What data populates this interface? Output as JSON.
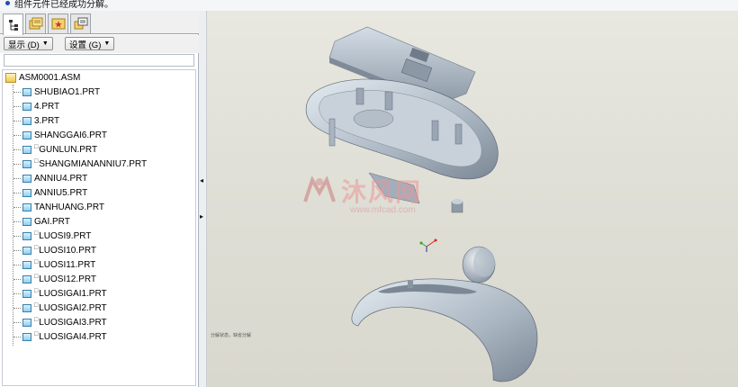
{
  "message_bar": {
    "text": "组件元件已经成功分解。"
  },
  "left_panel": {
    "tabs": [
      {
        "name": "model-tree-tab",
        "icon": "model-tree-icon"
      },
      {
        "name": "folder-browser-tab",
        "icon": "folder-browser-icon"
      },
      {
        "name": "favorites-tab",
        "icon": "favorites-icon"
      },
      {
        "name": "layers-tab",
        "icon": "layers-icon"
      }
    ],
    "show_button": "显示 (D)",
    "settings_button": "设置 (G)",
    "tree": {
      "root": "ASM0001.ASM",
      "items": [
        {
          "label": "SHUBIAO1.PRT",
          "marked": false
        },
        {
          "label": "4.PRT",
          "marked": false
        },
        {
          "label": "3.PRT",
          "marked": false
        },
        {
          "label": "SHANGGAI6.PRT",
          "marked": false
        },
        {
          "label": "GUNLUN.PRT",
          "marked": true
        },
        {
          "label": "SHANGMIANANNIU7.PRT",
          "marked": true
        },
        {
          "label": "ANNIU4.PRT",
          "marked": false
        },
        {
          "label": "ANNIU5.PRT",
          "marked": false
        },
        {
          "label": "TANHUANG.PRT",
          "marked": false
        },
        {
          "label": "GAI.PRT",
          "marked": false
        },
        {
          "label": "LUOSI9.PRT",
          "marked": true
        },
        {
          "label": "LUOSI10.PRT",
          "marked": true
        },
        {
          "label": "LUOSI11.PRT",
          "marked": true
        },
        {
          "label": "LUOSI12.PRT",
          "marked": true
        },
        {
          "label": "LUOSIGAI1.PRT",
          "marked": true
        },
        {
          "label": "LUOSIGAI2.PRT",
          "marked": true
        },
        {
          "label": "LUOSIGAI3.PRT",
          "marked": true
        },
        {
          "label": "LUOSIGAI4.PRT",
          "marked": true
        }
      ]
    }
  },
  "viewport": {
    "watermark_text": "沐风网",
    "watermark_url": "www.mfcad.com",
    "note": "分解状态，缺省分解"
  },
  "colors": {
    "viewport_bg": "#e3e2da",
    "model_fill": "#b9c4cf",
    "part_icon": "#8fd0ee",
    "assembly_icon": "#f0c94a"
  }
}
